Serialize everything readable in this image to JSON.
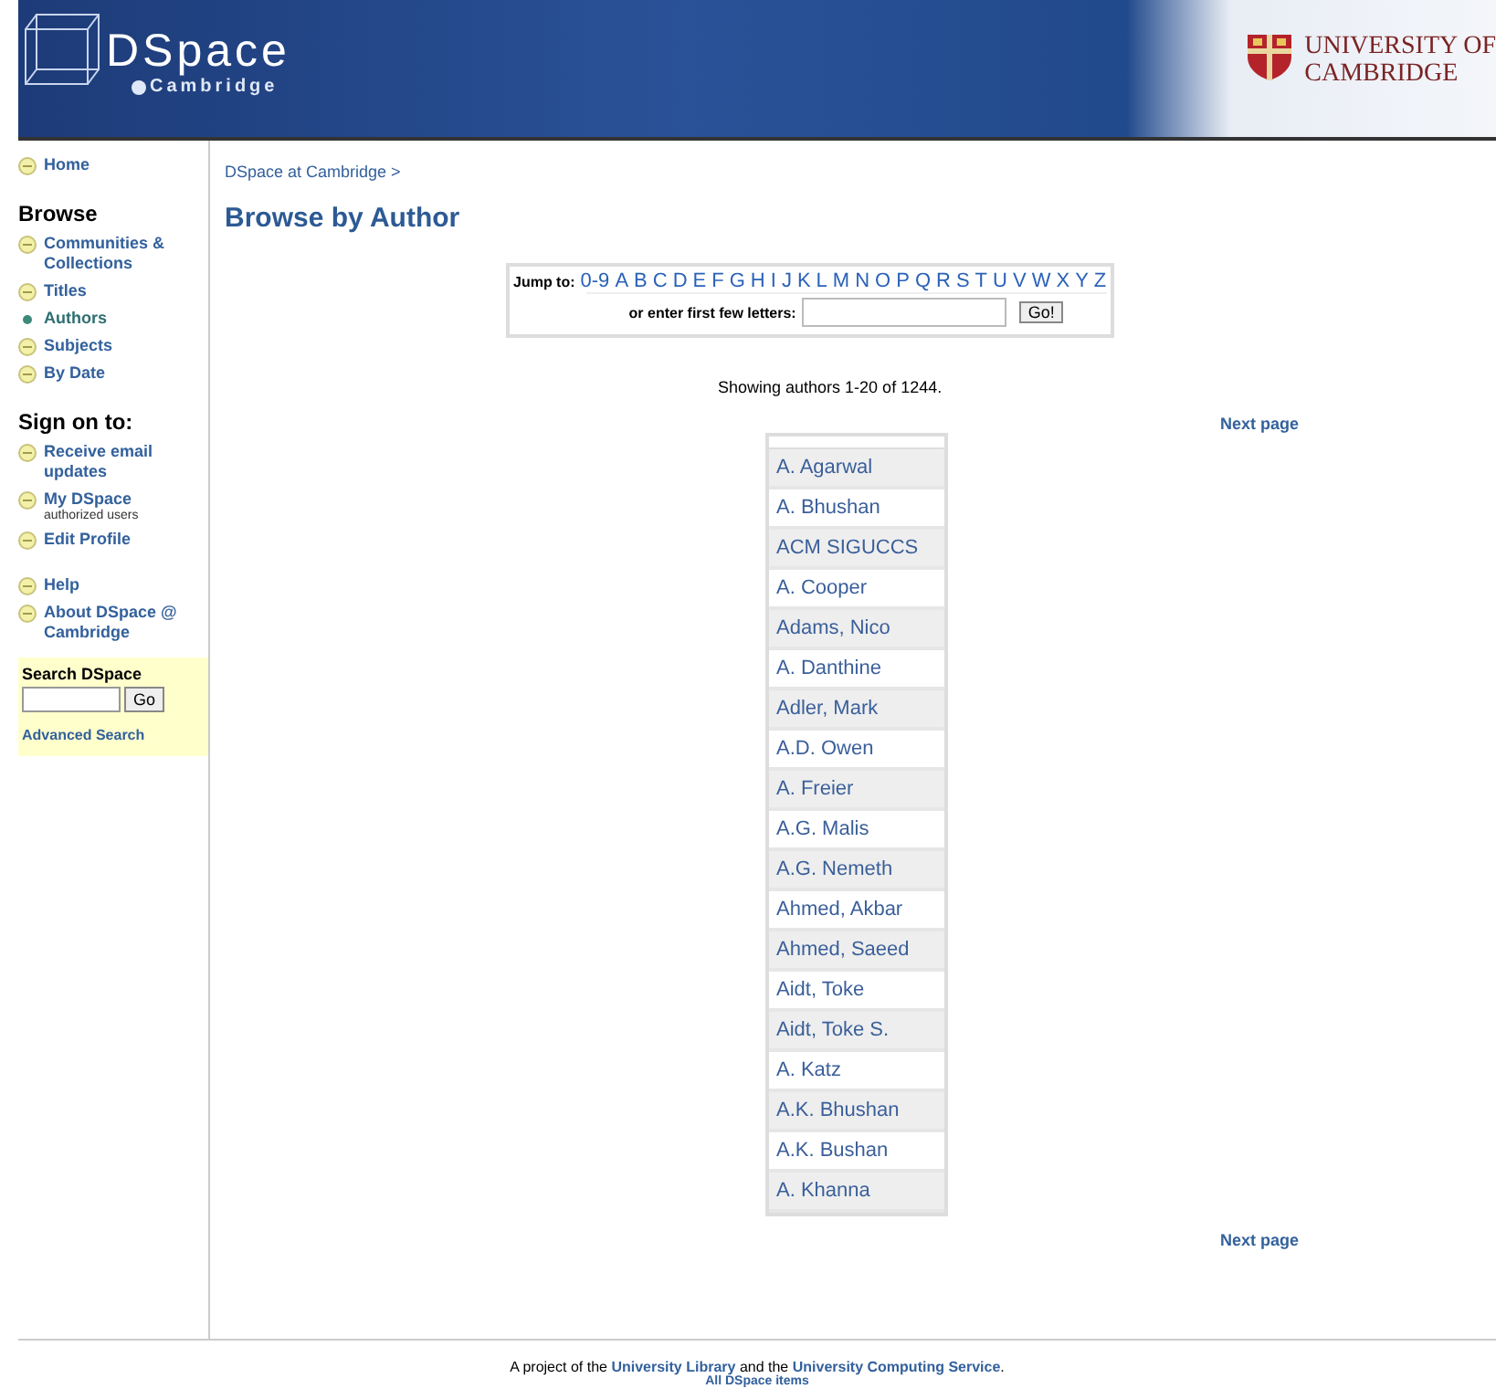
{
  "banner": {
    "logo": "DSpace",
    "logo_sub": "Cambridge",
    "university": [
      "UNIVERSITY OF",
      "CAMBRIDGE"
    ]
  },
  "sidebar": {
    "groups": [
      {
        "items": [
          {
            "label": "Home",
            "selected": false
          }
        ]
      },
      {
        "heading": "Browse",
        "items": [
          {
            "label": "Communities & Collections",
            "selected": false
          },
          {
            "label": "Titles",
            "selected": false
          },
          {
            "label": "Authors",
            "selected": true
          },
          {
            "label": "Subjects",
            "selected": false
          },
          {
            "label": "By Date",
            "selected": false
          }
        ]
      },
      {
        "heading": "Sign on to:",
        "items": [
          {
            "label": "Receive email updates",
            "selected": false
          },
          {
            "label": "My DSpace",
            "note": "authorized users",
            "selected": false
          },
          {
            "label": "Edit Profile",
            "selected": false
          }
        ]
      },
      {
        "items": [
          {
            "label": "Help",
            "selected": false
          },
          {
            "label": "About DSpace @ Cambridge",
            "selected": false
          }
        ]
      }
    ],
    "search": {
      "title": "Search DSpace",
      "button": "Go",
      "link": "Advanced Search"
    }
  },
  "breadcrumb": "DSpace at Cambridge >",
  "title": "Browse by Author",
  "jump": {
    "label": "Jump to:",
    "links": [
      "0-9",
      "A",
      "B",
      "C",
      "D",
      "E",
      "F",
      "G",
      "H",
      "I",
      "J",
      "K",
      "L",
      "M",
      "N",
      "O",
      "P",
      "Q",
      "R",
      "S",
      "T",
      "U",
      "V",
      "W",
      "X",
      "Y",
      "Z"
    ],
    "enter_label": "or enter first few letters:",
    "button": "Go!"
  },
  "showing": "Showing authors 1-20 of 1244.",
  "next_page": [
    "Next page",
    "Next page"
  ],
  "authors": [
    "A. Agarwal",
    "A. Bhushan",
    "ACM SIGUCCS",
    "A. Cooper",
    "Adams, Nico",
    "A. Danthine",
    "Adler, Mark",
    "A.D. Owen",
    "A. Freier",
    "A.G. Malis",
    "A.G. Nemeth",
    "Ahmed, Akbar",
    "Ahmed, Saeed",
    "Aidt, Toke",
    "Aidt, Toke S.",
    "A. Katz",
    "A.K. Bhushan",
    "A.K. Bushan",
    "A. Khanna"
  ],
  "footer": {
    "parts": [
      {
        "text": "A project of the ",
        "kind": "text"
      },
      {
        "text": "University Library",
        "kind": "link"
      },
      {
        "text": " and the ",
        "kind": "text"
      },
      {
        "text": "University Computing Service",
        "kind": "link"
      },
      {
        "text": ".",
        "kind": "text"
      }
    ],
    "second": "All DSpace items"
  }
}
